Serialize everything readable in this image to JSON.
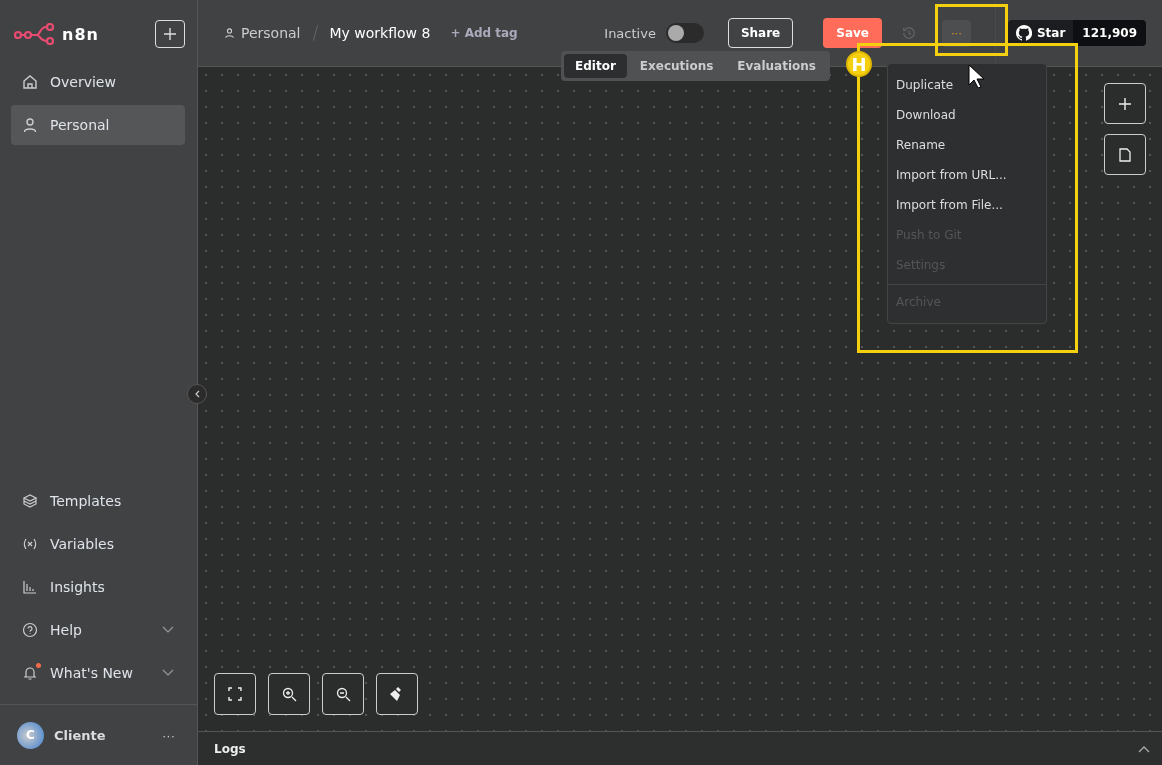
{
  "sidebar": {
    "logo": "n8n",
    "top_items": [
      {
        "label": "Overview",
        "selected": false
      },
      {
        "label": "Personal",
        "selected": true
      }
    ],
    "bottom_items": [
      {
        "label": "Templates",
        "expandable": false,
        "notification": false
      },
      {
        "label": "Variables",
        "expandable": false,
        "notification": false
      },
      {
        "label": "Insights",
        "expandable": false,
        "notification": false
      },
      {
        "label": "Help",
        "expandable": true,
        "notification": false
      },
      {
        "label": "What's New",
        "expandable": true,
        "notification": true
      }
    ],
    "user": {
      "initial": "C",
      "name": "Cliente",
      "more": "···"
    }
  },
  "header": {
    "project": "Personal",
    "workflow": "My workflow 8",
    "add_tag": "+ Add tag",
    "active_label": "Inactive",
    "active": false,
    "share": "Share",
    "save": "Save",
    "more": "···",
    "github": {
      "star": "Star",
      "count": "121,909"
    }
  },
  "view_tabs": [
    {
      "label": "Editor",
      "selected": true
    },
    {
      "label": "Executions",
      "selected": false
    },
    {
      "label": "Evaluations",
      "selected": false
    }
  ],
  "menu": [
    {
      "kind": "item",
      "label": "Duplicate",
      "disabled": false
    },
    {
      "kind": "item",
      "label": "Download",
      "disabled": false
    },
    {
      "kind": "item",
      "label": "Rename",
      "disabled": false
    },
    {
      "kind": "item",
      "label": "Import from URL...",
      "disabled": false
    },
    {
      "kind": "item",
      "label": "Import from File...",
      "disabled": false
    },
    {
      "kind": "item",
      "label": "Push to Git",
      "disabled": true
    },
    {
      "kind": "item",
      "label": "Settings",
      "disabled": true
    },
    {
      "kind": "divider"
    },
    {
      "kind": "item",
      "label": "Archive",
      "disabled": true
    }
  ],
  "highlight": {
    "marker": "H"
  },
  "logs": {
    "label": "Logs"
  }
}
